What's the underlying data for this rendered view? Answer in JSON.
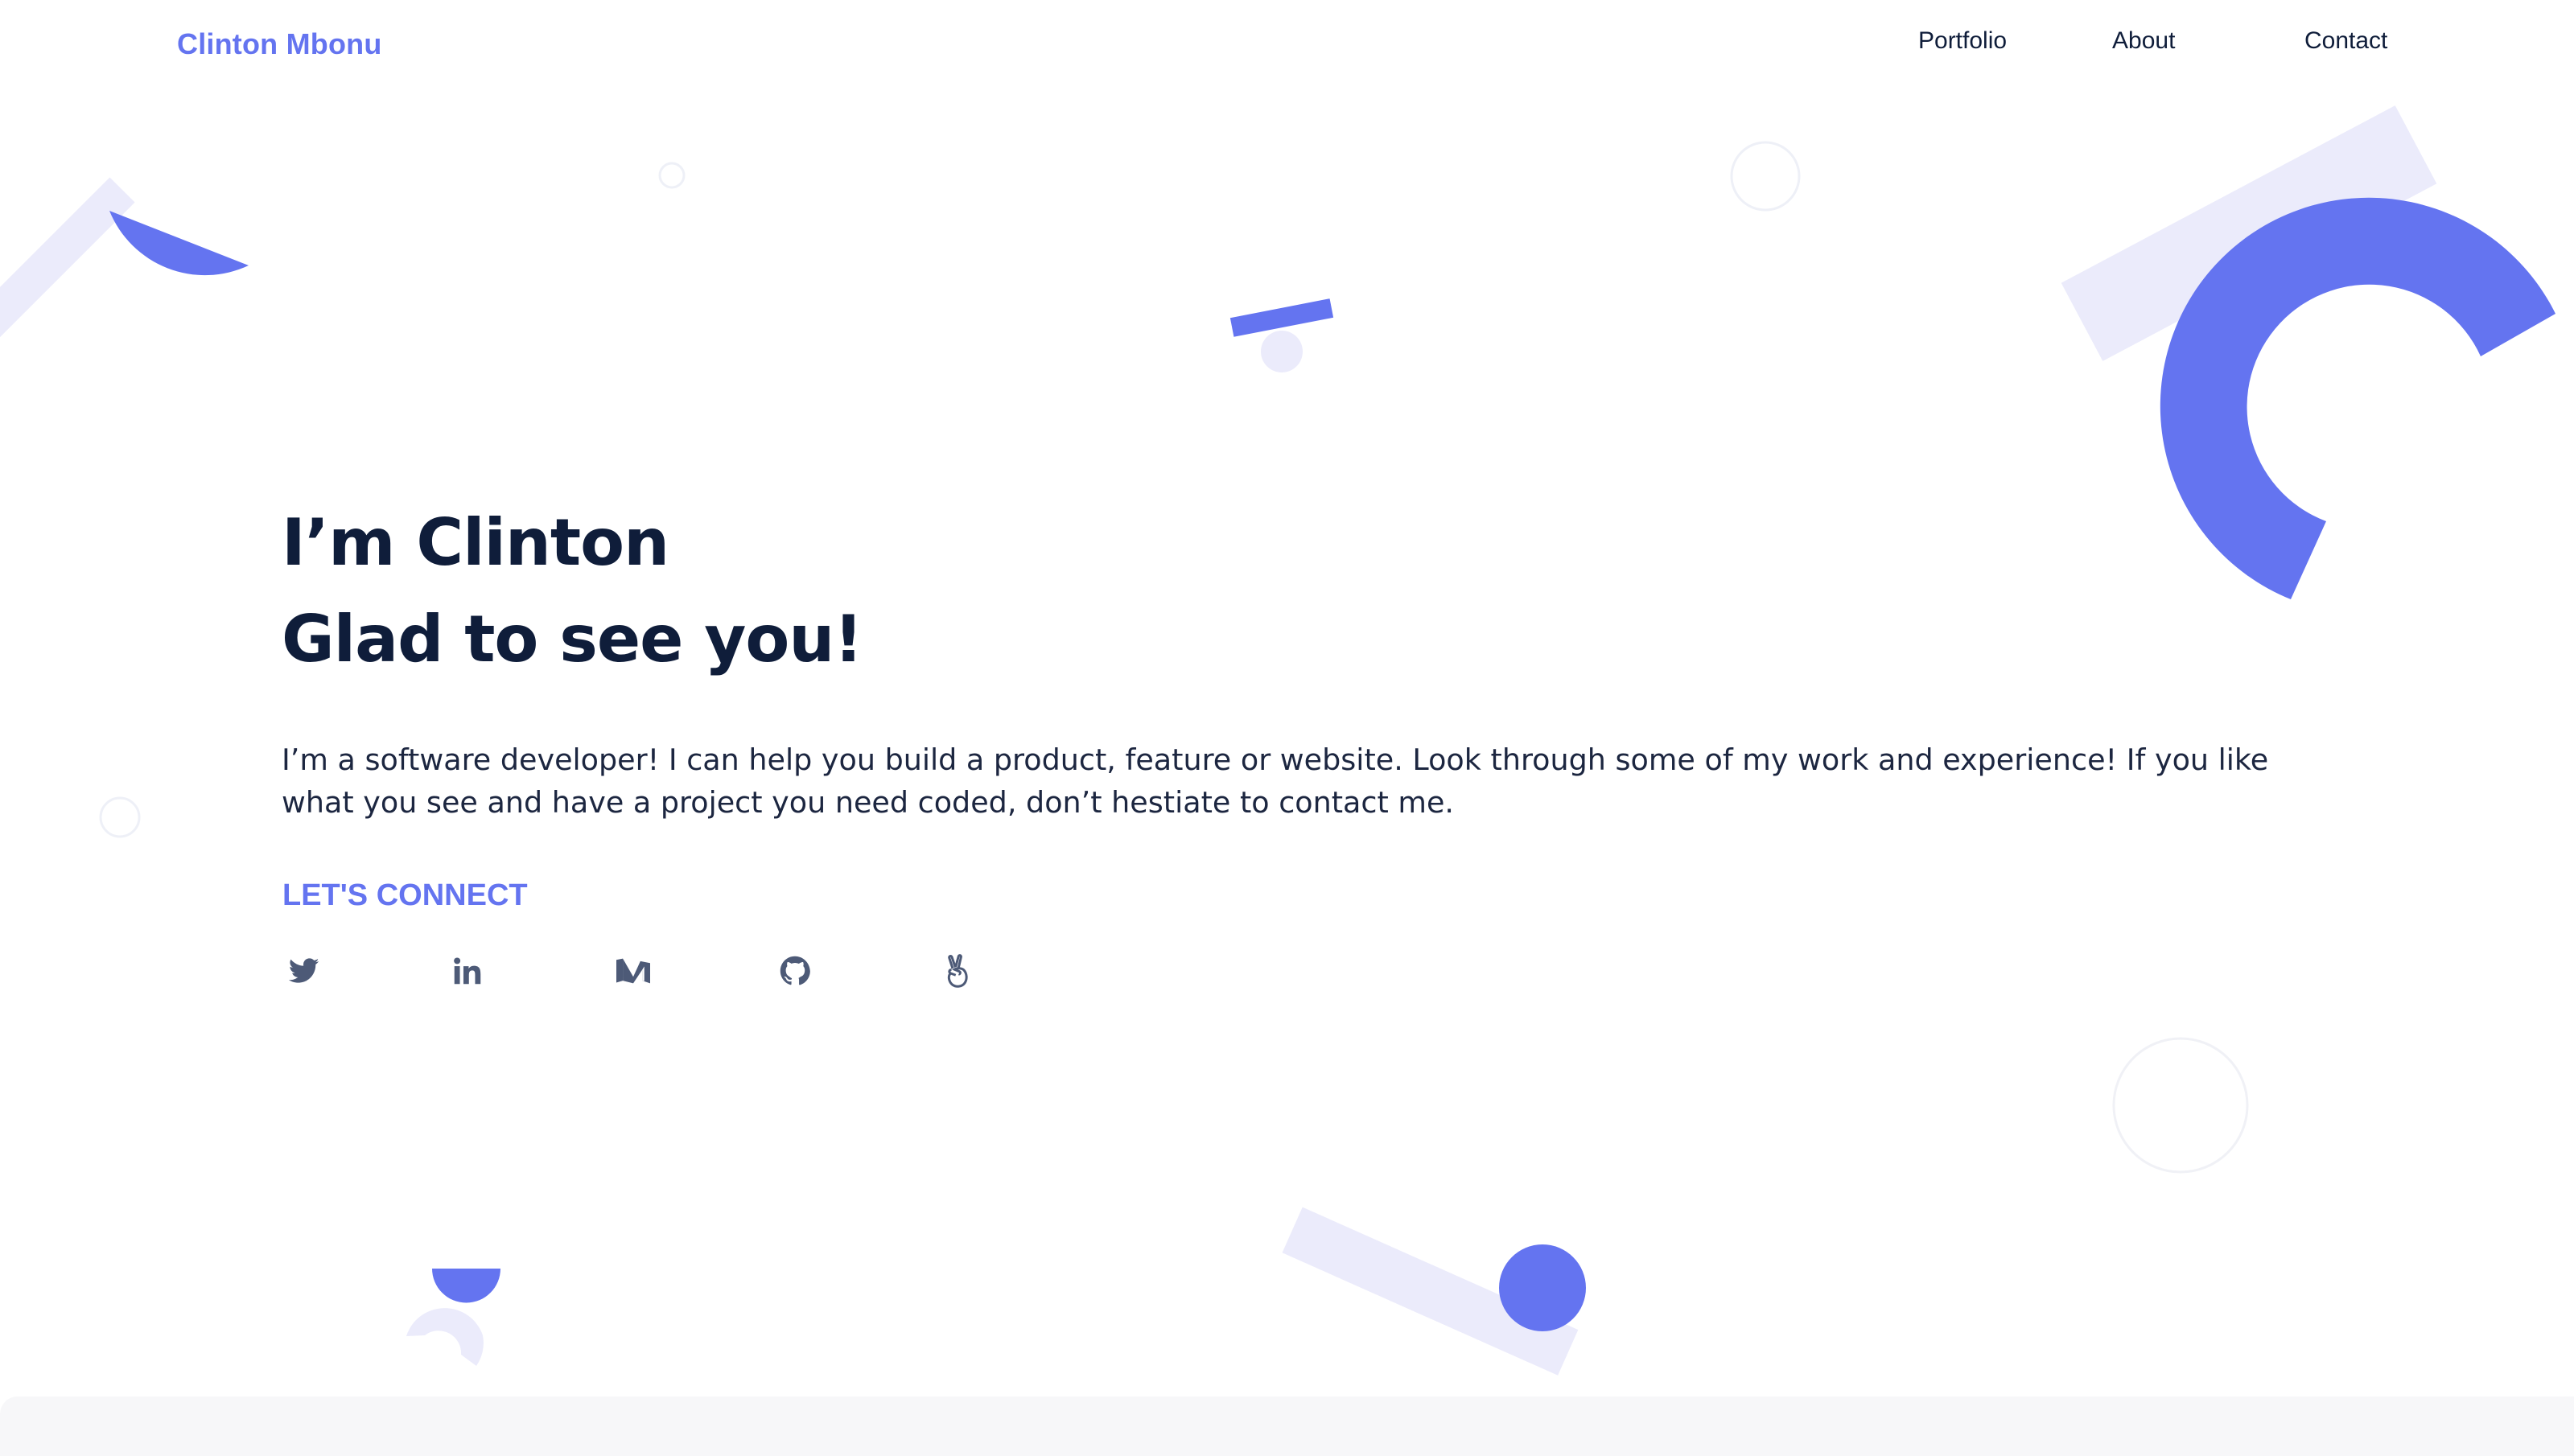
{
  "header": {
    "brand": "Clinton Mbonu",
    "nav": [
      {
        "label": "Portfolio"
      },
      {
        "label": "About"
      },
      {
        "label": "Contact"
      }
    ]
  },
  "hero": {
    "line1": "I’m Clinton",
    "line2": "Glad to see you!",
    "intro": "I’m a software developer! I can help you build a product, feature or website. Look through some of my work and experience! If you like what you see and have a project you need coded, don’t hestiate to contact me.",
    "connect_label": "LET'S CONNECT"
  },
  "social": [
    {
      "icon": "twitter-icon"
    },
    {
      "icon": "linkedin-icon"
    },
    {
      "icon": "medium-icon"
    },
    {
      "icon": "github-icon"
    },
    {
      "icon": "angellist-icon"
    }
  ],
  "colors": {
    "accent": "#6474f0",
    "accent_light": "#ebebfb",
    "heading": "#0f1d3a",
    "icon": "#4d5a77",
    "footer_band": "#f7f7f9"
  }
}
